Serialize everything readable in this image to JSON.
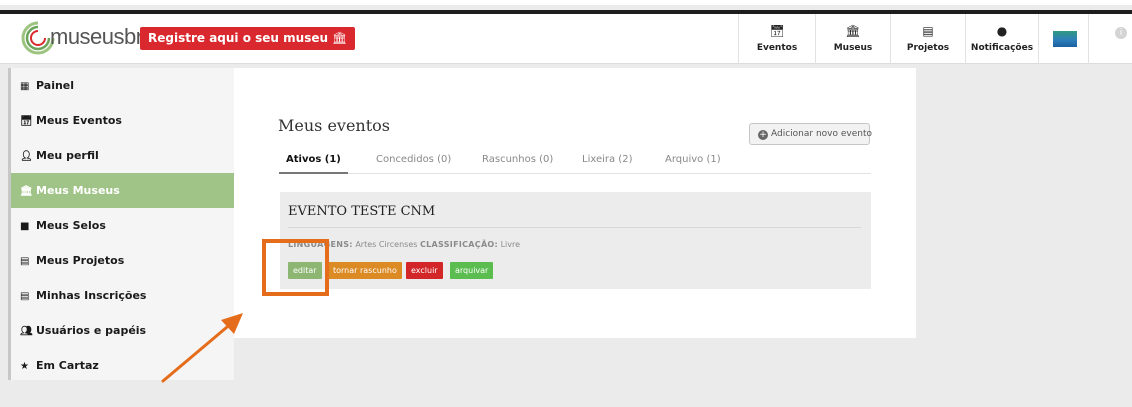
{
  "header": {
    "logo_text": "museusbr",
    "register_label": "Registre aqui o seu museu",
    "register_icon": "museum-icon",
    "nav": [
      {
        "label": "Eventos",
        "icon": "calendar-icon"
      },
      {
        "label": "Museus",
        "icon": "museum-icon"
      },
      {
        "label": "Projetos",
        "icon": "document-icon"
      },
      {
        "label": "Notificações",
        "icon": "speech-bubble-icon"
      }
    ],
    "info_icon": "info-icon"
  },
  "sidebar": {
    "items": [
      {
        "label": "Painel",
        "icon": "dashboard-icon"
      },
      {
        "label": "Meus Eventos",
        "icon": "calendar-icon"
      },
      {
        "label": "Meu perfil",
        "icon": "user-icon"
      },
      {
        "label": "Meus Museus",
        "icon": "museum-icon",
        "active": true
      },
      {
        "label": "Meus Selos",
        "icon": "bookmark-icon"
      },
      {
        "label": "Meus Projetos",
        "icon": "document-icon"
      },
      {
        "label": "Minhas Inscrições",
        "icon": "document-icon"
      },
      {
        "label": "Usuários e papéis",
        "icon": "users-icon"
      },
      {
        "label": "Em Cartaz",
        "icon": "star-icon"
      }
    ]
  },
  "main": {
    "title": "Meus eventos",
    "add_button": "Adicionar novo evento",
    "tabs": [
      {
        "label": "Ativos (1)",
        "active": true
      },
      {
        "label": "Concedidos (0)"
      },
      {
        "label": "Rascunhos (0)"
      },
      {
        "label": "Lixeira (2)"
      },
      {
        "label": "Arquivo (1)"
      }
    ],
    "event": {
      "title": "EVENTO TESTE CNM",
      "linguagens_key": "LINGUAGENS:",
      "linguagens_value": "Artes Circenses",
      "classificacao_key": "CLASSIFICAÇÃO:",
      "classificacao_value": "Livre",
      "actions": {
        "editar": "editar",
        "tornar_rascunho": "tornar rascunho",
        "excluir": "excluir",
        "arquivar": "arquivar"
      }
    }
  },
  "colors": {
    "accent_green": "#a0c488",
    "register_red": "#d9282e",
    "annotation_orange": "#e56c1a"
  }
}
